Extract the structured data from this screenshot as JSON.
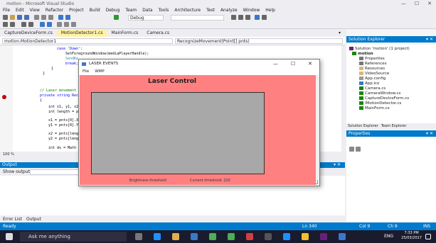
{
  "window": {
    "title": "motion - Microsoft Visual Studio",
    "min": "—",
    "max": "☐",
    "close": "✕"
  },
  "menu": [
    "File",
    "Edit",
    "View",
    "Refactor",
    "Project",
    "Build",
    "Debug",
    "Team",
    "Data",
    "Tools",
    "Architecture",
    "Test",
    "Analyze",
    "Window",
    "Help"
  ],
  "toolbar": {
    "config": "Debug"
  },
  "tabs": [
    "CaptureDeviceForm.cs",
    "MotionDetector1.cs",
    "MainForm.cs",
    "Camera.cs"
  ],
  "active_tab": "MotionDetector1.cs",
  "navbar": {
    "left": "motion.MotionDetector1",
    "right": "RecognizeMovement(Point[] pnts)"
  },
  "code": {
    "l1": "case 'Down':",
    "l2": "SetForegroundWindow(mediaPlayerHandle);",
    "l3": "SendKe",
    "l4": "break;",
    "l5": "}",
    "l6": "}",
    "l7": "// Laser movement",
    "l8": "private string Rec",
    "l9": "{",
    "l10": "int x1, y1, x2",
    "l11": "int length = p",
    "l12": "x1 = pnts[0].X",
    "l13": "y1 = pnts[0].Y",
    "l14": "x2 = pnts[leng",
    "l15": "y2 = pnts[leng",
    "l16": "int dx = Math"
  },
  "zoom": "100 %",
  "output": {
    "title": "Output",
    "show_from": "Show output from:"
  },
  "bottom_tabs": [
    "Error List",
    "Output"
  ],
  "solution_explorer": {
    "title": "Solution Explorer",
    "items": [
      "Solution 'motion' (1 project)",
      "motion",
      "Properties",
      "References",
      "Resources",
      "VideoSource",
      "App.config",
      "App.ico",
      "Camera.cs",
      "CameraWindow.cs",
      "CaptureDeviceForm.cs",
      "IMotionDetector.cs",
      "MainForm.cs"
    ],
    "tabs": [
      "Solution Explorer",
      "Team Explorer"
    ]
  },
  "properties": {
    "title": "Properties"
  },
  "status": {
    "left": "Ready",
    "ln": "Ln 340",
    "col": "Col 9",
    "ch": "Ch 9",
    "ins": "INS"
  },
  "taskbar": {
    "search": "Ask me anything",
    "time": "7:33 PM",
    "date": "25/03/2017",
    "lang": "ENG"
  },
  "dialog": {
    "title": "LASER EVENTS",
    "menu": [
      "File",
      "WMP"
    ],
    "heading": "Laser Control",
    "threshold_left": "Brightness threshold",
    "threshold_right": "Current threshold: 220"
  }
}
